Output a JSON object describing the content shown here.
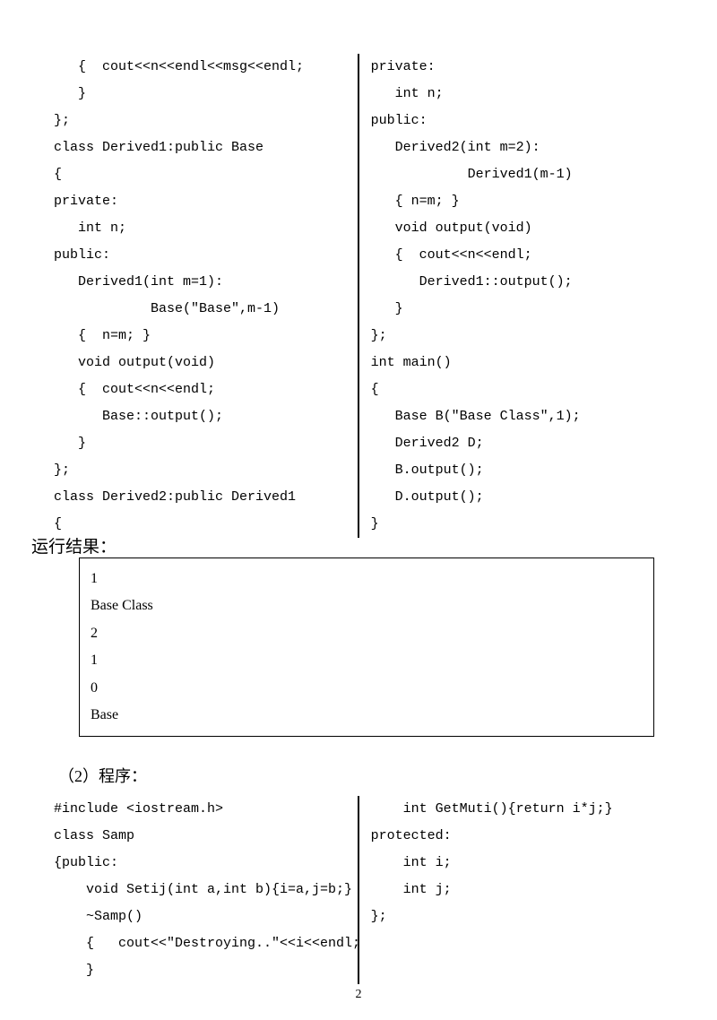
{
  "block1": {
    "left": "   {  cout<<n<<endl<<msg<<endl;\n   }\n};\nclass Derived1:public Base\n{\nprivate:\n   int n;\npublic:\n   Derived1(int m=1):\n            Base(\"Base\",m-1)\n   {  n=m; }\n   void output(void)\n   {  cout<<n<<endl;\n      Base::output();\n   }\n};\nclass Derived2:public Derived1\n{",
    "right": "private:\n   int n;\npublic:\n   Derived2(int m=2):\n            Derived1(m-1)\n   { n=m; }\n   void output(void)\n   {  cout<<n<<endl;\n      Derived1::output();\n   }\n};\nint main()\n{\n   Base B(\"Base Class\",1);\n   Derived2 D;\n   B.output();\n   D.output();\n}"
  },
  "result_label": "运行结果：",
  "output": "1\nBase Class\n2\n1\n0\nBase",
  "sec2_label": "（2）程序：",
  "block2": {
    "left": "#include <iostream.h>\nclass Samp\n{public:\n    void Setij(int a,int b){i=a,j=b;}\n    ~Samp()\n    {   cout<<\"Destroying..\"<<i<<endl;\n    }",
    "right": "    int GetMuti(){return i*j;}\nprotected:\n    int i;\n    int j;\n};"
  },
  "page_number": "2"
}
